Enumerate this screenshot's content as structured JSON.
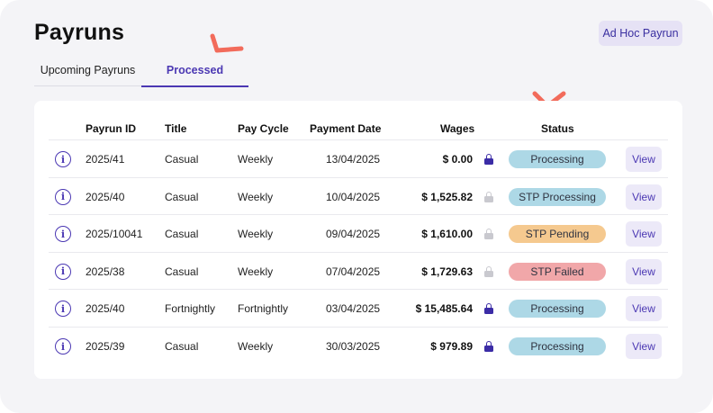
{
  "header": {
    "title": "Payruns",
    "ad_hoc_label": "Ad Hoc Payrun"
  },
  "tabs": [
    {
      "label": "Upcoming Payruns",
      "active": false
    },
    {
      "label": "Processed",
      "active": true
    }
  ],
  "table": {
    "columns": [
      "Payrun ID",
      "Title",
      "Pay Cycle",
      "Payment Date",
      "Wages",
      "Status"
    ],
    "rows": [
      {
        "id": "2025/41",
        "title": "Casual",
        "cycle": "Weekly",
        "date": "13/04/2025",
        "wages": "$ 0.00",
        "locked": true,
        "status": "Processing",
        "status_color": "#add8e6",
        "action": "View"
      },
      {
        "id": "2025/40",
        "title": "Casual",
        "cycle": "Weekly",
        "date": "10/04/2025",
        "wages": "$ 1,525.82",
        "locked": false,
        "status": "STP Processing",
        "status_color": "#add8e6",
        "action": "View"
      },
      {
        "id": "2025/10041",
        "title": "Casual",
        "cycle": "Weekly",
        "date": "09/04/2025",
        "wages": "$ 1,610.00",
        "locked": false,
        "status": "STP Pending",
        "status_color": "#f5c98f",
        "action": "View"
      },
      {
        "id": "2025/38",
        "title": "Casual",
        "cycle": "Weekly",
        "date": "07/04/2025",
        "wages": "$ 1,729.63",
        "locked": false,
        "status": "STP Failed",
        "status_color": "#f1a7a9",
        "action": "View"
      },
      {
        "id": "2025/40",
        "title": "Fortnightly",
        "cycle": "Fortnightly",
        "date": "03/04/2025",
        "wages": "$ 15,485.64",
        "locked": true,
        "status": "Processing",
        "status_color": "#add8e6",
        "action": "View"
      }
    ],
    "last_row": {
      "id": "2025/39",
      "title": "Casual",
      "cycle": "Weekly",
      "date": "30/03/2025",
      "wages": "$ 979.89",
      "locked": true,
      "status": "Processing",
      "status_color": "#add8e6",
      "action": "View"
    }
  },
  "colors": {
    "accent": "#4b38b3",
    "lock_active": "#3b2ca6",
    "lock_inactive": "#c9c9cf",
    "annotation": "#f26b5b"
  },
  "icons": {
    "info": "info-circle-icon",
    "lock": "lock-icon",
    "annotation": "check-mark-annotation"
  }
}
